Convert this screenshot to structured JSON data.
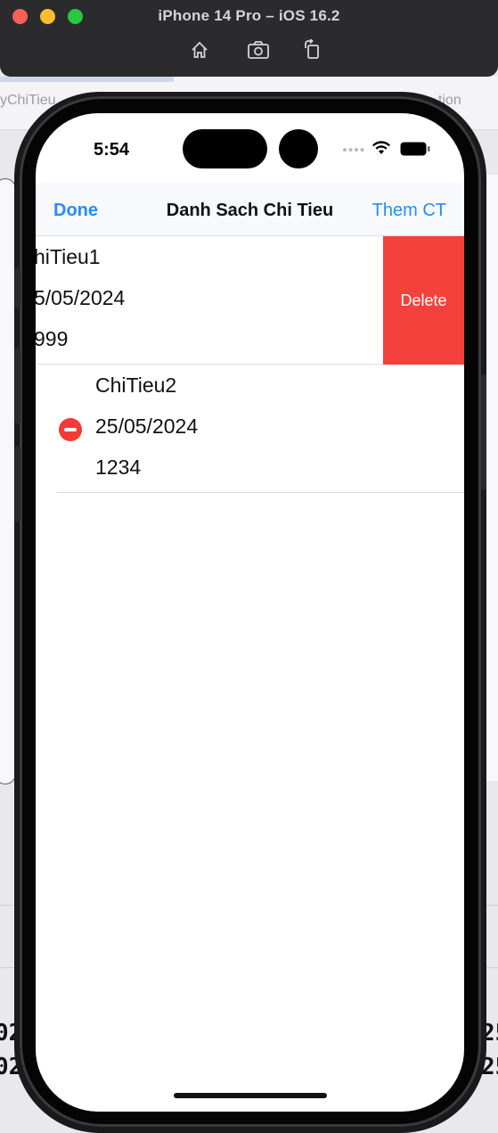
{
  "simulator": {
    "title": "iPhone 14 Pro – iOS 16.2",
    "tools": [
      "home-icon",
      "screenshot-icon",
      "rotate-icon"
    ],
    "colors": {
      "close": "#fe5f57",
      "minimize": "#febc2e",
      "zoom": "#28c840"
    }
  },
  "background": {
    "tab_left": "yChiTieu",
    "tab_right": "tion",
    "bold_left": [
      "02",
      "02"
    ],
    "bold_right": [
      "25",
      "25"
    ]
  },
  "status_bar": {
    "time": "5:54",
    "icons": [
      "signal-icon",
      "wifi-icon",
      "battery-icon"
    ]
  },
  "navbar": {
    "left_button": "Done",
    "title": "Danh Sach Chi Tieu",
    "right_button": "Them CT",
    "accent": "#2a8cf0"
  },
  "rows": [
    {
      "name": "hiTieu1",
      "date": "5/05/2024",
      "amount": "999",
      "action": "Delete"
    },
    {
      "name": "ChiTieu2",
      "date": "25/05/2024",
      "amount": "1234",
      "action_icon": "minus-circle-icon"
    }
  ],
  "colors": {
    "delete": "#f5413b"
  }
}
